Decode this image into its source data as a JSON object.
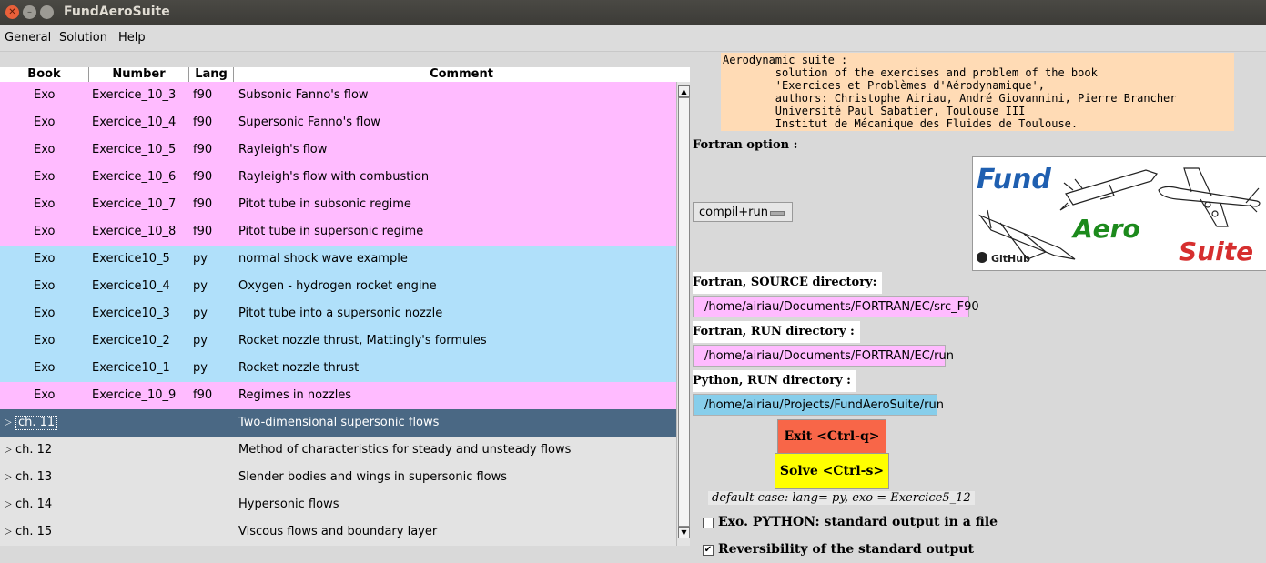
{
  "window": {
    "title": "FundAeroSuite"
  },
  "menubar": {
    "items": [
      "General",
      "Solution",
      "Help"
    ]
  },
  "tree": {
    "columns": [
      "Book",
      "Number",
      "Lang",
      "Comment"
    ],
    "rows": [
      {
        "book": "Exo",
        "number": "Exercice_10_3",
        "lang": "f90",
        "comment": "Subsonic Fanno's flow",
        "color": "pink"
      },
      {
        "book": "Exo",
        "number": "Exercice_10_4",
        "lang": "f90",
        "comment": "Supersonic Fanno's flow",
        "color": "pink"
      },
      {
        "book": "Exo",
        "number": "Exercice_10_5",
        "lang": "f90",
        "comment": "Rayleigh's flow",
        "color": "pink"
      },
      {
        "book": "Exo",
        "number": "Exercice_10_6",
        "lang": "f90",
        "comment": "Rayleigh's flow with combustion",
        "color": "pink"
      },
      {
        "book": "Exo",
        "number": "Exercice_10_7",
        "lang": "f90",
        "comment": "Pitot tube in subsonic regime",
        "color": "pink"
      },
      {
        "book": "Exo",
        "number": "Exercice_10_8",
        "lang": "f90",
        "comment": "Pitot tube in supersonic regime",
        "color": "pink"
      },
      {
        "book": "Exo",
        "number": "Exercice10_5",
        "lang": "py",
        "comment": "normal shock wave example",
        "color": "blue"
      },
      {
        "book": "Exo",
        "number": "Exercice10_4",
        "lang": "py",
        "comment": "Oxygen - hydrogen rocket engine",
        "color": "blue"
      },
      {
        "book": "Exo",
        "number": "Exercice10_3",
        "lang": "py",
        "comment": "Pitot tube into a supersonic nozzle",
        "color": "blue"
      },
      {
        "book": "Exo",
        "number": "Exercice10_2",
        "lang": "py",
        "comment": "Rocket nozzle thrust, Mattingly's formules",
        "color": "blue"
      },
      {
        "book": "Exo",
        "number": "Exercice10_1",
        "lang": "py",
        "comment": "Rocket nozzle thrust",
        "color": "blue"
      },
      {
        "book": "Exo",
        "number": "Exercice_10_9",
        "lang": "f90",
        "comment": "Regimes in nozzles",
        "color": "pink"
      }
    ],
    "chapters": [
      {
        "label": "ch. 11",
        "comment": "Two-dimensional supersonic flows",
        "selected": true
      },
      {
        "label": "ch. 12",
        "comment": "Method of characteristics for steady and unsteady flows",
        "selected": false
      },
      {
        "label": "ch. 13",
        "comment": "Slender bodies and wings in supersonic flows",
        "selected": false
      },
      {
        "label": "ch. 14",
        "comment": "Hypersonic flows",
        "selected": false
      },
      {
        "label": "ch. 15",
        "comment": "Viscous flows and boundary layer",
        "selected": false
      }
    ]
  },
  "info": {
    "text": "Aerodynamic suite :\n        solution of the exercises and problem of the book\n        'Exercices et Problèmes d'Aérodynamique',\n        authors: Christophe Airiau, André Giovannini, Pierre Brancher\n        Université Paul Sabatier, Toulouse III\n        Institut de Mécanique des Fluides de Toulouse."
  },
  "fortran_option": {
    "label": "Fortran option :",
    "value": "compil+run"
  },
  "logo": {
    "word1": "Fund",
    "word2": "Aero",
    "word3": "Suite",
    "badge": "GitHub"
  },
  "dirs": {
    "fortran_source_label": "Fortran, SOURCE directory:",
    "fortran_source": "/home/airiau/Documents/FORTRAN/EC/src_F90",
    "fortran_run_label": "Fortran, RUN directory :",
    "fortran_run": "/home/airiau/Documents/FORTRAN/EC/run",
    "python_run_label": "Python, RUN directory :",
    "python_run": "/home/airiau/Projects/FundAeroSuite/run"
  },
  "buttons": {
    "exit": "Exit <Ctrl-q>",
    "solve": "Solve <Ctrl-s>"
  },
  "default_case": "default case: lang= py, exo = Exercice5_12",
  "checks": [
    {
      "label": "Exo. PYTHON: standard output in a file",
      "checked": false
    },
    {
      "label": "Reversibility of the standard output",
      "checked": true
    }
  ],
  "colors": {
    "pink": "#ffbbff",
    "blue": "#b0e0fa",
    "selected": "#4a6884",
    "exit": "#f86648",
    "solve": "#ffff00",
    "info": "#ffdbb5"
  }
}
